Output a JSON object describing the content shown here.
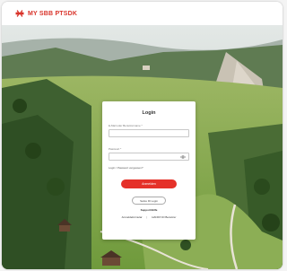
{
  "header": {
    "logo_text": "MY SBB PTSDK"
  },
  "login": {
    "title": "Login",
    "email_label": "E-Mail oder Benutzername *",
    "email_value": "",
    "password_label": "Passwort *",
    "password_value": "",
    "forgot_password": "Login / Passwort vergessen?",
    "primary_button": "Anmelden",
    "secondary_button": "Swiss ID Login",
    "support_title": "Support/Hilfe",
    "links": [
      "Anmeldeformular",
      "HANDY-ID Benutzer"
    ]
  },
  "colors": {
    "accent": "#e53129",
    "logo": "#d9342b"
  }
}
